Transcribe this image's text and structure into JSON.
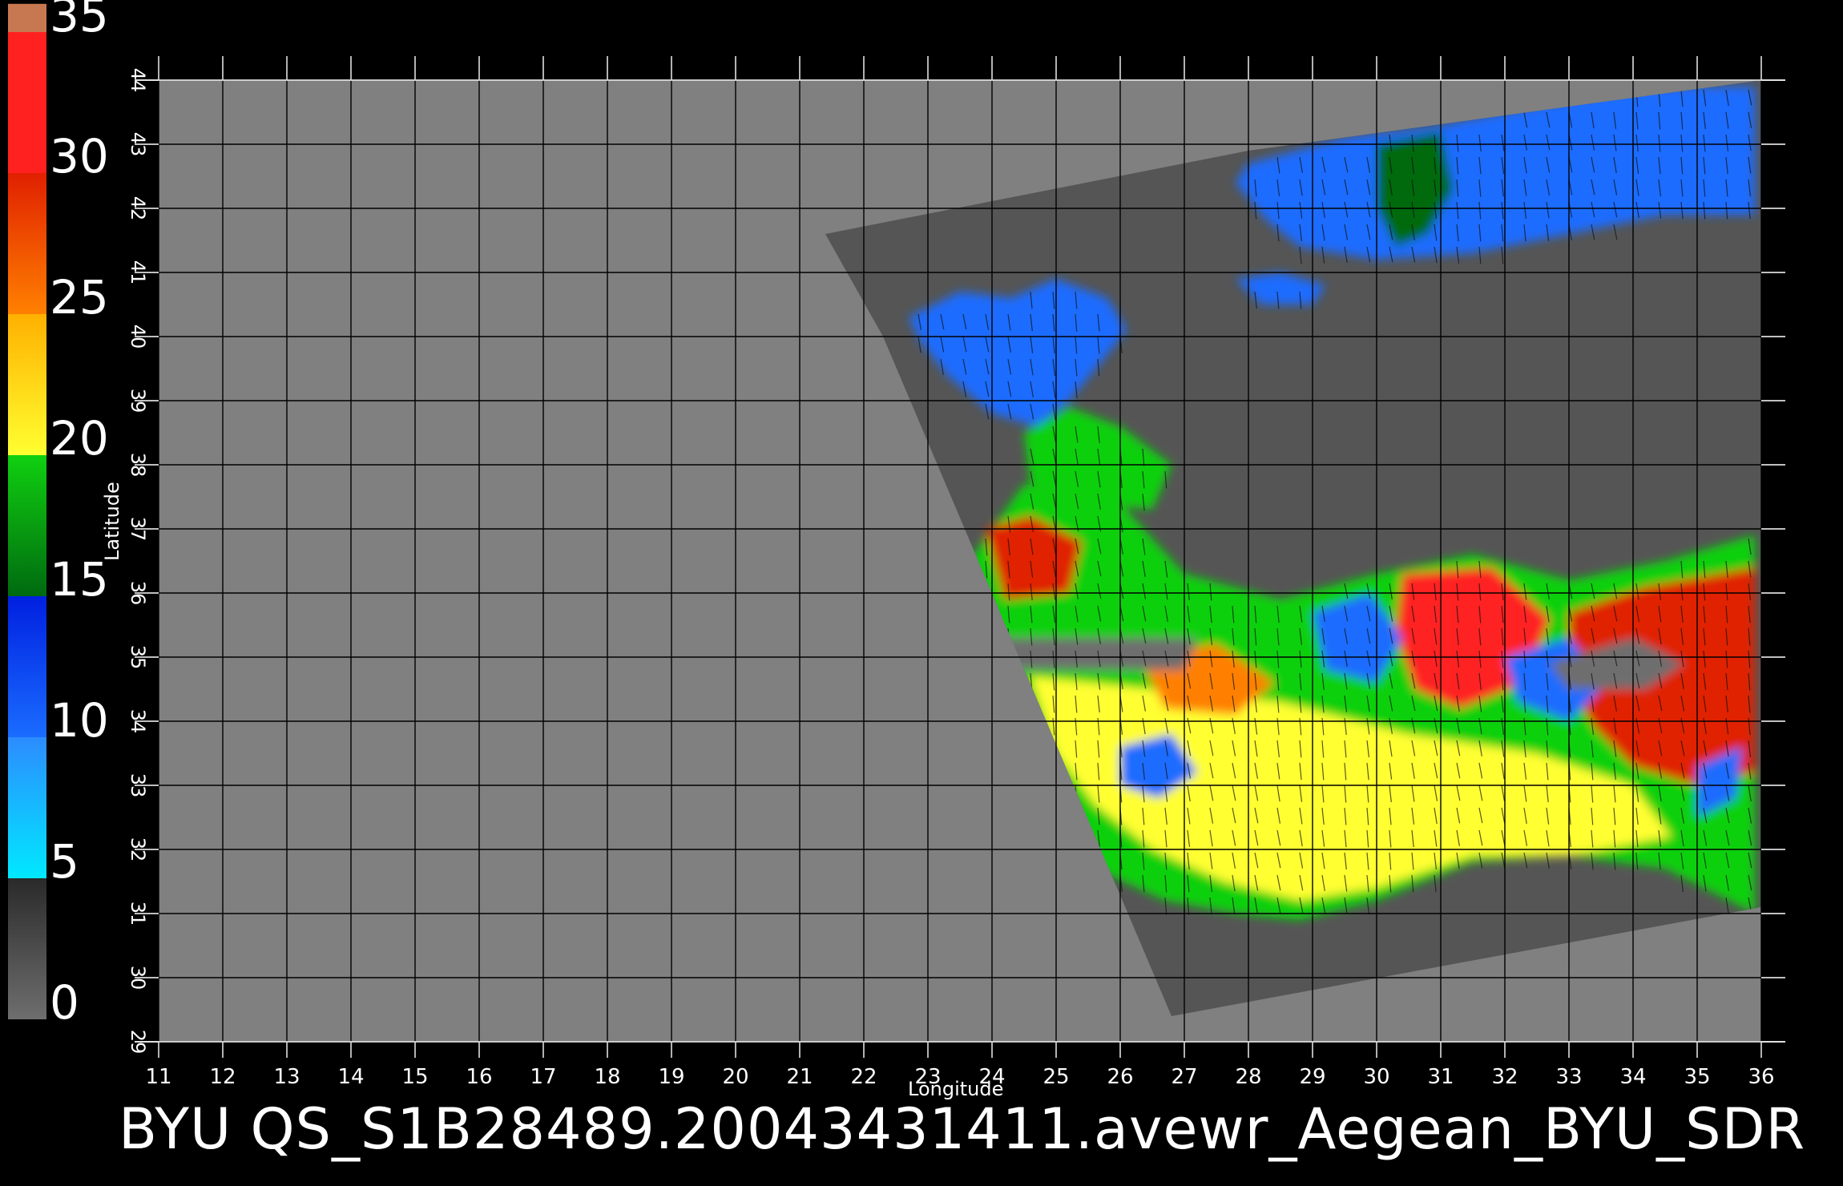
{
  "chart_data": {
    "type": "heatmap",
    "xlabel": "Longitude",
    "ylabel": "Latitude",
    "xlim": [
      11,
      36
    ],
    "ylim": [
      29,
      44
    ],
    "x_ticks": [
      11,
      12,
      13,
      14,
      15,
      16,
      17,
      18,
      19,
      20,
      21,
      22,
      23,
      24,
      25,
      26,
      27,
      28,
      29,
      30,
      31,
      32,
      33,
      34,
      35,
      36
    ],
    "y_ticks": [
      29,
      30,
      31,
      32,
      33,
      34,
      35,
      36,
      37,
      38,
      39,
      40,
      41,
      42,
      43,
      44
    ],
    "grid": true,
    "colorbar": {
      "ticks": [
        0,
        5,
        10,
        15,
        20,
        25,
        30,
        35
      ],
      "range": [
        0,
        35
      ],
      "bands": [
        {
          "from": 0,
          "to": 5,
          "colors": [
            "#6e6e6e",
            "#2a2a2a"
          ]
        },
        {
          "from": 5,
          "to": 10,
          "colors": [
            "#00e8ff",
            "#2c8cff"
          ]
        },
        {
          "from": 10,
          "to": 15,
          "colors": [
            "#1a6cff",
            "#0020e0"
          ]
        },
        {
          "from": 15,
          "to": 20,
          "colors": [
            "#006a10",
            "#10d010"
          ]
        },
        {
          "from": 20,
          "to": 25,
          "colors": [
            "#ffff30",
            "#ffb000"
          ]
        },
        {
          "from": 25,
          "to": 30,
          "colors": [
            "#ff8000",
            "#e02000"
          ]
        },
        {
          "from": 30,
          "to": 35,
          "colors": [
            "#ff2020",
            "#ff2020"
          ]
        },
        {
          "from": 35,
          "to": 36,
          "colors": [
            "#c87850",
            "#c87850"
          ]
        }
      ]
    },
    "colors": {
      "land_background": "#808080",
      "swath_no_data": "#555555",
      "grid_line": "#000000",
      "wind_vector": "#111111"
    },
    "swath": [
      [
        21.4,
        41.6
      ],
      [
        28.0,
        42.9
      ],
      [
        36,
        44
      ],
      [
        36,
        31.1
      ],
      [
        26.8,
        29.4
      ],
      [
        22.3,
        40.0
      ]
    ],
    "regions": [
      {
        "level": 10,
        "polygon": [
          [
            28.0,
            42.7
          ],
          [
            29.5,
            43.1
          ],
          [
            31.0,
            43.3
          ],
          [
            32.5,
            43.6
          ],
          [
            34.0,
            43.9
          ],
          [
            35.9,
            43.9
          ],
          [
            35.9,
            41.9
          ],
          [
            34.5,
            41.9
          ],
          [
            33.0,
            41.6
          ],
          [
            31.5,
            41.3
          ],
          [
            30.0,
            41.2
          ],
          [
            28.8,
            41.4
          ],
          [
            28.3,
            41.8
          ],
          [
            27.8,
            42.4
          ]
        ]
      },
      {
        "level": 17,
        "polygon": [
          [
            30.0,
            43.0
          ],
          [
            31.0,
            43.2
          ],
          [
            31.2,
            42.3
          ],
          [
            30.8,
            41.6
          ],
          [
            30.3,
            41.4
          ],
          [
            30.0,
            42.0
          ]
        ]
      },
      {
        "level": 10,
        "polygon": [
          [
            22.7,
            40.3
          ],
          [
            23.5,
            40.7
          ],
          [
            24.3,
            40.6
          ],
          [
            25.0,
            40.9
          ],
          [
            25.8,
            40.6
          ],
          [
            26.1,
            40.1
          ],
          [
            25.7,
            39.6
          ],
          [
            25.2,
            39.0
          ],
          [
            24.7,
            38.6
          ],
          [
            24.0,
            38.8
          ],
          [
            23.3,
            39.4
          ],
          [
            22.9,
            39.9
          ]
        ]
      },
      {
        "level": 18,
        "polygon": [
          [
            24.5,
            38.5
          ],
          [
            25.2,
            38.9
          ],
          [
            26.0,
            38.6
          ],
          [
            26.8,
            38.0
          ],
          [
            26.5,
            37.3
          ],
          [
            25.6,
            37.4
          ],
          [
            24.6,
            37.7
          ]
        ]
      },
      {
        "level": 11,
        "polygon": [
          [
            27.8,
            40.9
          ],
          [
            28.5,
            41.0
          ],
          [
            29.2,
            40.8
          ],
          [
            29.0,
            40.5
          ],
          [
            28.2,
            40.5
          ]
        ]
      },
      {
        "level": 18,
        "polygon": [
          [
            23.5,
            36.3
          ],
          [
            24.5,
            37.7
          ],
          [
            26.0,
            37.4
          ],
          [
            27.0,
            36.3
          ],
          [
            28.5,
            35.9
          ],
          [
            30.0,
            36.3
          ],
          [
            31.5,
            36.6
          ],
          [
            33.0,
            36.2
          ],
          [
            34.5,
            36.5
          ],
          [
            35.9,
            36.9
          ],
          [
            35.9,
            31.0
          ],
          [
            34.5,
            31.7
          ],
          [
            33.0,
            31.9
          ],
          [
            31.5,
            31.8
          ],
          [
            30.0,
            31.2
          ],
          [
            28.8,
            30.9
          ],
          [
            27.8,
            31.0
          ],
          [
            26.7,
            31.2
          ],
          [
            25.6,
            31.7
          ],
          [
            25.0,
            32.3
          ],
          [
            24.4,
            33.3
          ],
          [
            23.8,
            34.8
          ]
        ]
      },
      {
        "level": 21,
        "polygon": [
          [
            24.6,
            34.7
          ],
          [
            26.5,
            34.5
          ],
          [
            28.5,
            34.3
          ],
          [
            30.5,
            33.8
          ],
          [
            32.5,
            33.5
          ],
          [
            34.0,
            33.0
          ],
          [
            34.6,
            32.2
          ],
          [
            33.0,
            31.9
          ],
          [
            31.5,
            31.9
          ],
          [
            30.0,
            31.4
          ],
          [
            28.8,
            31.2
          ],
          [
            27.6,
            31.5
          ],
          [
            26.5,
            32.0
          ],
          [
            25.6,
            32.7
          ],
          [
            25.0,
            33.5
          ]
        ]
      },
      {
        "level": 30,
        "polygon": [
          [
            30.4,
            36.3
          ],
          [
            31.8,
            36.4
          ],
          [
            32.7,
            35.6
          ],
          [
            32.3,
            34.6
          ],
          [
            31.3,
            34.2
          ],
          [
            30.6,
            34.5
          ],
          [
            30.3,
            35.4
          ]
        ]
      },
      {
        "level": 29,
        "polygon": [
          [
            33.0,
            35.7
          ],
          [
            34.2,
            36.1
          ],
          [
            35.9,
            36.4
          ],
          [
            35.9,
            33.2
          ],
          [
            35.0,
            33.0
          ],
          [
            34.0,
            33.3
          ],
          [
            33.4,
            33.9
          ],
          [
            33.0,
            34.6
          ]
        ]
      },
      {
        "level": 29,
        "polygon": [
          [
            23.9,
            37.0
          ],
          [
            24.6,
            37.2
          ],
          [
            25.4,
            36.8
          ],
          [
            25.2,
            36.0
          ],
          [
            24.2,
            35.9
          ]
        ]
      },
      {
        "level": 27,
        "polygon": [
          [
            26.3,
            35.0
          ],
          [
            27.5,
            35.2
          ],
          [
            28.4,
            34.6
          ],
          [
            27.8,
            34.1
          ],
          [
            26.7,
            34.2
          ]
        ]
      },
      {
        "level": 12,
        "polygon": [
          [
            29.0,
            35.7
          ],
          [
            29.9,
            36.0
          ],
          [
            30.4,
            35.3
          ],
          [
            30.0,
            34.6
          ],
          [
            29.2,
            34.8
          ]
        ]
      },
      {
        "level": 11,
        "polygon": [
          [
            32.0,
            35.0
          ],
          [
            33.0,
            35.3
          ],
          [
            33.6,
            34.6
          ],
          [
            33.0,
            34.0
          ],
          [
            32.2,
            34.3
          ]
        ]
      },
      {
        "level": 10,
        "polygon": [
          [
            35.0,
            33.3
          ],
          [
            35.7,
            33.6
          ],
          [
            35.6,
            32.8
          ],
          [
            35.0,
            32.5
          ]
        ]
      },
      {
        "level": 11,
        "polygon": [
          [
            26.0,
            33.6
          ],
          [
            26.8,
            33.8
          ],
          [
            27.2,
            33.2
          ],
          [
            26.6,
            32.8
          ],
          [
            26.0,
            33.0
          ]
        ]
      },
      {
        "level": 1,
        "polygon": [
          [
            23.8,
            35.3
          ],
          [
            27.2,
            35.3
          ],
          [
            27.0,
            34.8
          ],
          [
            24.3,
            34.8
          ]
        ]
      },
      {
        "level": 1,
        "polygon": [
          [
            32.7,
            34.9
          ],
          [
            34.0,
            35.3
          ],
          [
            34.8,
            34.9
          ],
          [
            34.2,
            34.5
          ],
          [
            33.0,
            34.5
          ]
        ]
      }
    ]
  },
  "footer": {
    "text": "BYU  QS_S1B28489.20043431411.avewr_Aegean_BYU_SDR"
  }
}
